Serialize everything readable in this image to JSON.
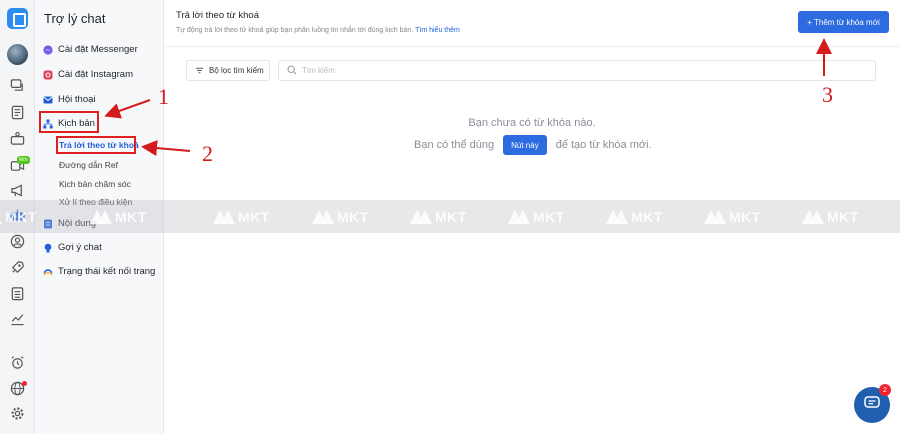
{
  "sidebar": {
    "title": "Trợ lý chat",
    "items": [
      {
        "label": "Cài đặt Messenger"
      },
      {
        "label": "Cài đặt Instagram"
      },
      {
        "label": "Hội thoại"
      },
      {
        "label": "Kịch bản"
      },
      {
        "label": "Nội dung"
      },
      {
        "label": "Gợi ý chat"
      },
      {
        "label": "Trạng thái kết nối trang"
      }
    ],
    "subitems": [
      {
        "label": "Trả lời theo từ khoá"
      },
      {
        "label": "Đường dẫn Ref"
      },
      {
        "label": "Kịch bản chăm sóc"
      },
      {
        "label": "Xử lí theo điều kiện"
      }
    ]
  },
  "rail": {
    "new_badge": "Mới",
    "icons": [
      "chat-bubbles-icon",
      "document-icon",
      "camera-icon",
      "video-icon",
      "megaphone-icon",
      "bot-icon",
      "user-circle-icon",
      "rocket-icon",
      "clipboard-icon",
      "analytics-icon",
      "alarm-icon",
      "globe-icon",
      "gear-icon"
    ]
  },
  "main": {
    "title": "Trả lời theo từ khoá",
    "description": "Tự động trả lời theo từ khoá giúp bạn phân luồng tin nhắn tới đúng kịch bản.",
    "learn_more": "Tìm hiểu thêm",
    "add_button": "+ Thêm từ khóa mới",
    "filter_button": "Bộ lọc tìm kiếm",
    "search_placeholder": "Tìm kiếm",
    "empty_title": "Bạn chưa có từ khóa nào.",
    "empty_prefix": "Bạn có thể dùng",
    "empty_button": "Nút này",
    "empty_suffix": "để tạo từ khóa mới."
  },
  "watermark": {
    "text": "MKT"
  },
  "annotations": {
    "n1": "1",
    "n2": "2",
    "n3": "3"
  },
  "chat_widget": {
    "badge": "2"
  },
  "colors": {
    "accent": "#2c6be0",
    "annotation": "#e02020"
  }
}
